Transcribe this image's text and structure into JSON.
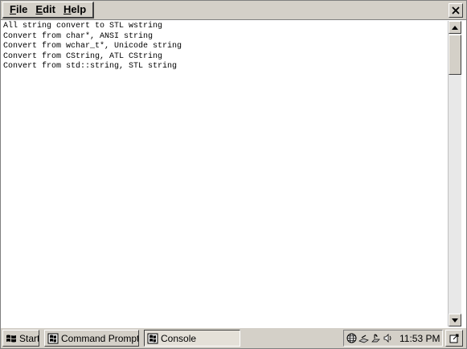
{
  "menubar": {
    "items": [
      {
        "label": "File",
        "accel": "F",
        "rest": "ile"
      },
      {
        "label": "Edit",
        "accel": "E",
        "rest": "dit"
      },
      {
        "label": "Help",
        "accel": "H",
        "rest": "elp"
      }
    ],
    "close_icon": "close-icon"
  },
  "console": {
    "lines": [
      "All string convert to STL wstring",
      "Convert from char*, ANSI string",
      "Convert from wchar_t*, Unicode string",
      "Convert from CString, ATL CString",
      "Convert from std::string, STL string"
    ]
  },
  "scrollbar": {
    "up_icon": "scroll-up-arrow-icon",
    "down_icon": "scroll-down-arrow-icon"
  },
  "taskbar": {
    "start_label": "Start",
    "buttons": [
      {
        "label": "Command Prompt",
        "icon": "command-prompt-icon"
      },
      {
        "label": "Console",
        "icon": "console-icon",
        "active": true
      }
    ],
    "tray_icons": [
      "network-icon",
      "connection-icon",
      "connection-icon",
      "volume-icon"
    ],
    "clock": "11:53 PM",
    "desktop_icon": "show-desktop-icon"
  }
}
